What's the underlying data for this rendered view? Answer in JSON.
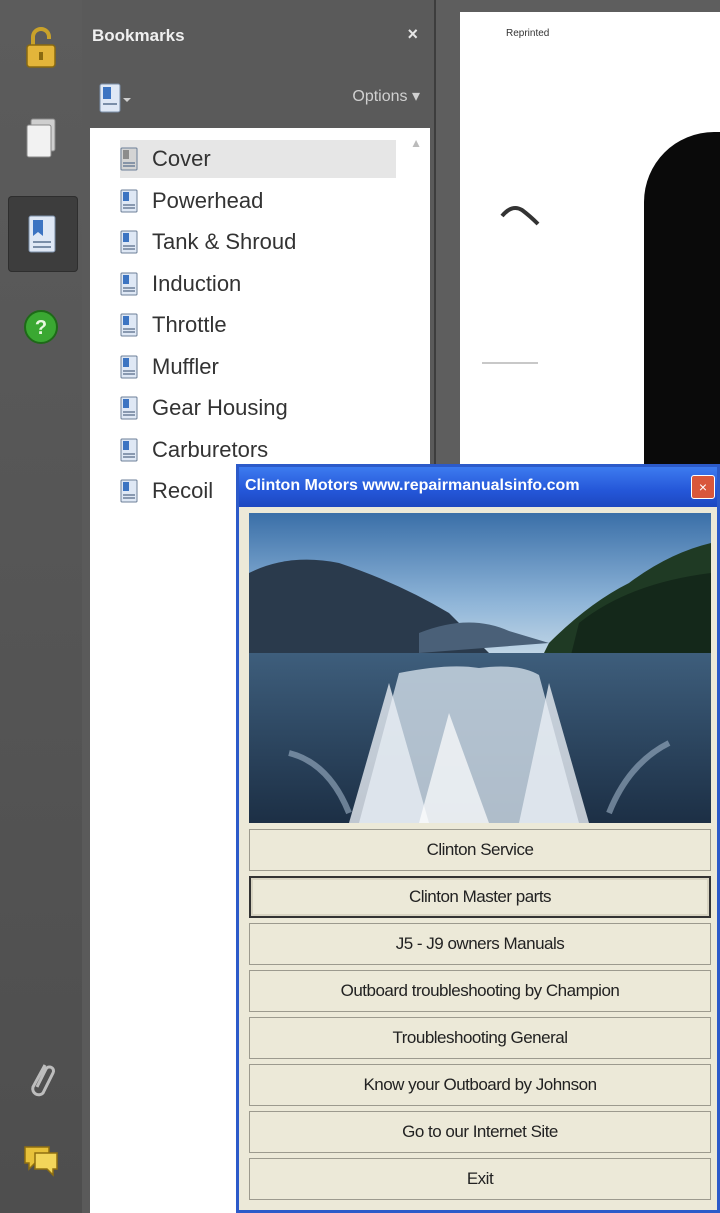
{
  "rail": {
    "icons": [
      "lock-icon",
      "pages-icon",
      "bookmarks-icon",
      "help-icon",
      "attachment-icon",
      "comment-icon"
    ]
  },
  "bookmarks": {
    "title": "Bookmarks",
    "close": "×",
    "options_label": "Options ▾",
    "items": [
      {
        "label": "Cover",
        "selected": true
      },
      {
        "label": "Powerhead"
      },
      {
        "label": "Tank & Shroud"
      },
      {
        "label": "Induction"
      },
      {
        "label": "Throttle"
      },
      {
        "label": "Muffler"
      },
      {
        "label": "Gear Housing"
      },
      {
        "label": "Carburetors"
      },
      {
        "label": "Recoil"
      }
    ]
  },
  "document": {
    "header_text": "Reprinted"
  },
  "dialog": {
    "title": "Clinton Motors www.repairmanualsinfo.com",
    "close": "×",
    "buttons": [
      "Clinton Service",
      "Clinton Master parts",
      "J5 - J9 owners Manuals",
      "Outboard troubleshooting by Champion",
      "Troubleshooting General",
      "Know your Outboard by Johnson",
      "Go to our Internet Site",
      "Exit"
    ],
    "focused_index": 1
  },
  "colors": {
    "titlebar": "#2456d8",
    "dialog_bg": "#ece9d8",
    "panel_bg": "#5a5a5a"
  }
}
